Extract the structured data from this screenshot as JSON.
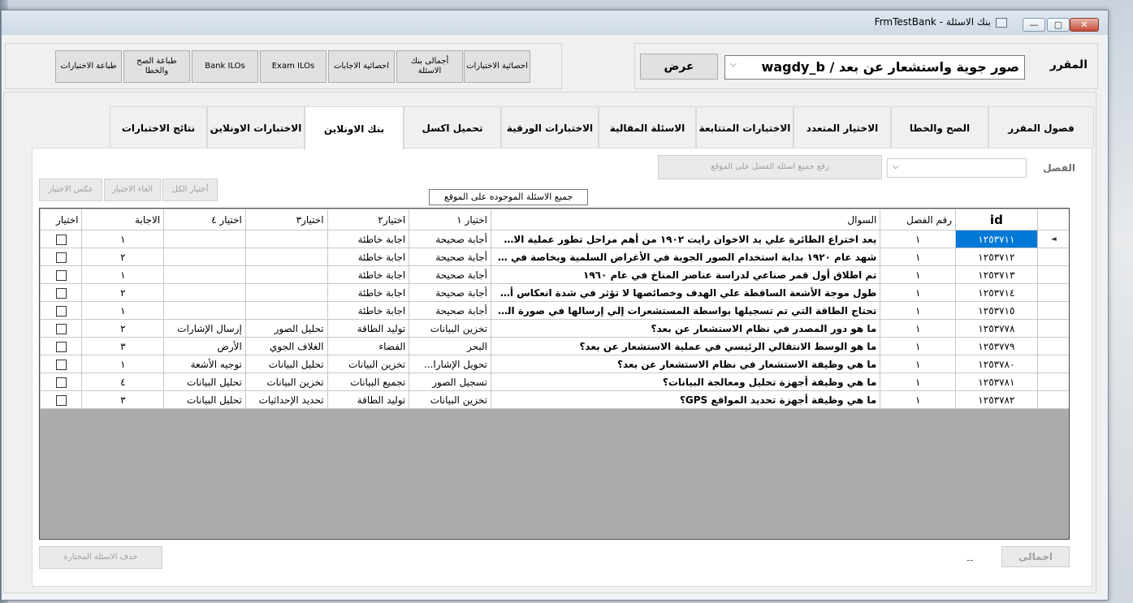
{
  "window": {
    "title": "بنك الاسئلة - FrmTestBank",
    "buttons": {
      "minimize": "—",
      "maximize": "▢",
      "close": "✕"
    }
  },
  "course": {
    "label": "المقرر",
    "selected": "صور جوية واستشعار عن بعد / wagdy_b",
    "show_button": "عرض"
  },
  "toolbar": {
    "exam_stats": "احصائية الاختبارات",
    "bank_total": "أجمالى بنك الاسئلة",
    "answer_stats": "احصائية الاجابات",
    "exam_ilos": "Exam ILOs",
    "bank_ilos": "Bank ILOs",
    "print_tf": "طباعة الصح والخطا",
    "print_exams": "طباعة الاختبارات"
  },
  "tabs": [
    "فصول المقرر",
    "الصح والخطا",
    "الاختيار المتعدد",
    "الاختبارات المتتابعة",
    "الاسئلة المقالية",
    "الاختبارات الورقية",
    "تحميل اكسل",
    "بنك الاونلاين",
    "الاختبارات الاونلاين",
    "نتائج الاختبارات"
  ],
  "online_bank": {
    "chapter_label": "الفصل",
    "upload_button": "رفع جميع اسئلة الفصل على الموقع",
    "all_questions_label": "جميع الاسئلة الموجوده على الموقع",
    "select_all": "أختيار الكل",
    "deselect": "الغاء الاختيار",
    "invert": "عكس الاختيار",
    "delete_selected": "حذف الاسئلة المختارة",
    "total_button": "اجمالى",
    "total_value": "--"
  },
  "grid": {
    "headers": [
      "id",
      "رقم الفصل",
      "السوال",
      "اختيار ١",
      "اختيار٢",
      "اختيار٣",
      "اختيار ٤",
      "الاجابة",
      "اختيار"
    ],
    "rows": [
      [
        "١٢٥٣٧١١",
        "١",
        "يعد اختراع الطائرة علي يد الاخوان رايت ١٩٠٢ من أهم مراحل تطور عملية الاستشعار ...",
        "أجابة صحيحة",
        "اجابة خاطئة",
        "",
        "",
        "١"
      ],
      [
        "١٢٥٣٧١٢",
        "١",
        "شهد عام ١٩٢٠ بداية استخدام الصور الجوية في الأغراض السلمية وبخاصة في مجالات...",
        "أجابة صحيحة",
        "اجابة خاطئة",
        "",
        "",
        "٢"
      ],
      [
        "١٢٥٣٧١٣",
        "١",
        "تم اطلاق أول قمر صناعي لدراسة عناصر المناخ في عام ١٩٦٠",
        "أجابة صحيحة",
        "اجابة خاطئة",
        "",
        "",
        "١"
      ],
      [
        "١٢٥٣٧١٤",
        "١",
        "طول موجة الأشعة الساقطة علي الهدف وخصائصها لا تؤثر  في شدة انعكاس أو انبعاث أ...",
        "أجابة صحيحة",
        "اجابة خاطئة",
        "",
        "",
        "٢"
      ],
      [
        "١٢٥٣٧١٥",
        "١",
        "تحتاج الطاقة التي تم تسجيلها بواسطة المستشعرات إلي إرسالها في صورة الكترونية غا...",
        "أجابة صحيحة",
        "اجابة خاطئة",
        "",
        "",
        "١"
      ],
      [
        "١٢٥٣٧٧٨",
        "١",
        "ما هو دور المصدر في نظام الاستشعار عن بعد؟",
        "تخزين البيانات",
        "توليد الطاقة",
        "تحليل الصور",
        "إرسال الإشارات",
        "٢"
      ],
      [
        "١٢٥٣٧٧٩",
        "١",
        "ما هو الوسط الانتقالي الرئيسي في عملية الاستشعار عن بعد؟",
        "البحر",
        "الفضاء",
        "الغلاف الجوي",
        "الأرض",
        "٣"
      ],
      [
        "١٢٥٣٧٨٠",
        "١",
        "ما هي وظيفة الاستشعار في نظام الاستشعار عن بعد؟",
        "تحويل الإشارا...",
        "تخزين البيانات",
        "تحليل البيانات",
        "توجيه الأشعة",
        "١"
      ],
      [
        "١٢٥٣٧٨١",
        "١",
        "ما هي وظيفة أجهزة تحليل ومعالجة البيانات؟",
        "تسجيل الصور",
        "تجميع البيانات",
        "تخزين البيانات",
        "تحليل البيانات",
        "٤"
      ],
      [
        "١٢٥٣٧٨٢",
        "١",
        "ما هي وظيفة أجهزة تحديد المواقع GPS؟",
        "تخزين البيانات",
        "توليد الطاقة",
        "تحديد الإحداثيات",
        "تحليل البيانات",
        "٣"
      ]
    ]
  }
}
